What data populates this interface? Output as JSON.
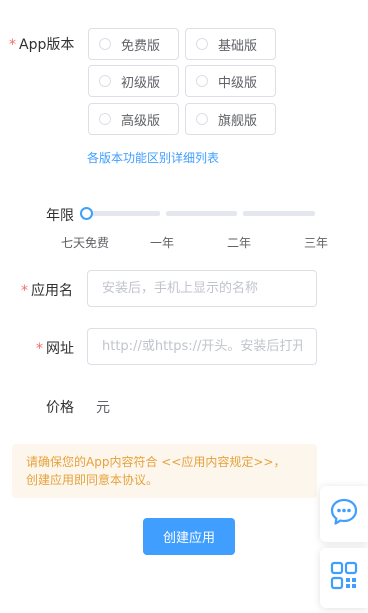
{
  "form": {
    "version": {
      "label": "App版本",
      "required_mark": "*",
      "options": [
        "免费版",
        "基础版",
        "初级版",
        "中级版",
        "高级版",
        "旗舰版"
      ],
      "compare_link": "各版本功能区别详细列表"
    },
    "years": {
      "label": "年限",
      "ticks": [
        "七天免费",
        "一年",
        "二年",
        "三年"
      ],
      "selected_index": 0
    },
    "app_name": {
      "label": "应用名",
      "required_mark": "*",
      "placeholder": "安装后，手机上显示的名称"
    },
    "website": {
      "label": "网址",
      "required_mark": "*",
      "placeholder": "http://或https://开头。安装后打开对"
    },
    "price": {
      "label": "价格",
      "value": "元"
    }
  },
  "notice": {
    "line1": "请确保您的App内容符合 <<应用内容规定>>，",
    "line2": "创建应用即同意本协议。"
  },
  "actions": {
    "create_label": "创建应用"
  },
  "colors": {
    "primary": "#409eff",
    "required": "#f56c6c",
    "notice_bg": "#fdf6ec",
    "notice_text": "#e6a23c"
  },
  "floating": {
    "icons": [
      "chat-bubble-icon",
      "qr-code-icon"
    ]
  }
}
